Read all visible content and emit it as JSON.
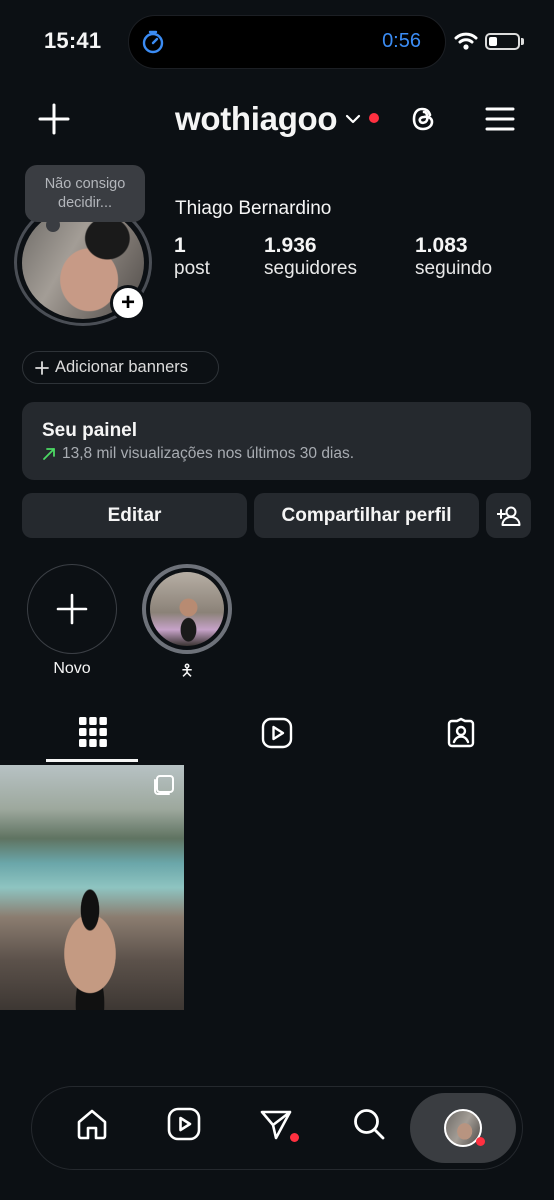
{
  "status_bar": {
    "time": "15:41",
    "island_timer": "0:56",
    "battery_level": 0.3
  },
  "header": {
    "username": "wothiagoo"
  },
  "profile": {
    "note": "Não consigo decidir...",
    "full_name": "Thiago Bernardino",
    "stats": [
      {
        "value": "1",
        "label": "post"
      },
      {
        "value": "1.936",
        "label": "seguidores"
      },
      {
        "value": "1.083",
        "label": "seguindo"
      }
    ]
  },
  "banners": {
    "label": "Adicionar banners"
  },
  "panel": {
    "title": "Seu painel",
    "subtitle": "13,8 mil visualizações nos últimos 30 dias."
  },
  "actions": {
    "edit_label": "Editar",
    "share_label": "Compartilhar perfil"
  },
  "highlights": [
    {
      "label": "Novo"
    },
    {
      "label": "🯅"
    }
  ],
  "tabs": [
    "grid-icon",
    "reels-icon",
    "tagged-icon"
  ],
  "colors": {
    "background": "#0c1014",
    "surface": "#25292e",
    "notification_red": "#ff3040",
    "island_blue": "#3b8cf4",
    "trend_green": "#4cd964"
  }
}
